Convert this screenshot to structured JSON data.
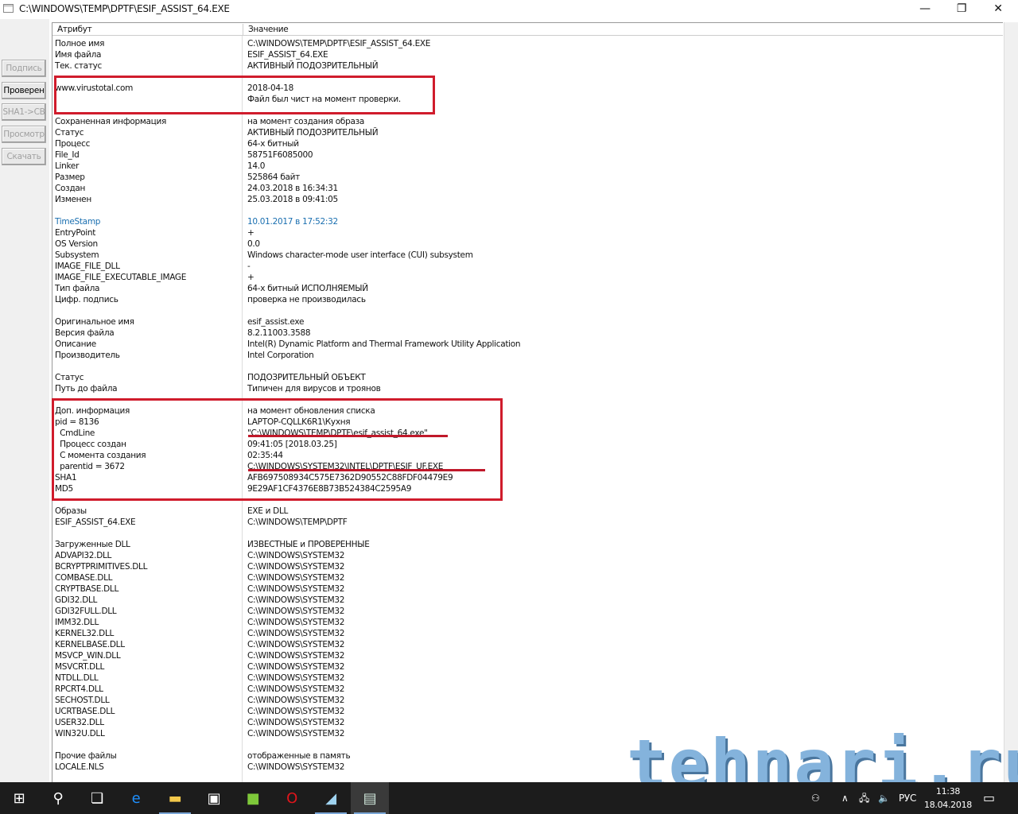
{
  "window": {
    "title": "C:\\WINDOWS\\TEMP\\DPTF\\ESIF_ASSIST_64.EXE",
    "minimize": "—",
    "maximize": "❐",
    "close": "✕"
  },
  "side_buttons": [
    {
      "label": "Подпись",
      "enabled": false
    },
    {
      "label": "Проверен",
      "enabled": true
    },
    {
      "label": "SHA1->CB",
      "enabled": false
    },
    {
      "label": "Просмотр",
      "enabled": false
    },
    {
      "label": "Скачать",
      "enabled": false
    }
  ],
  "table": {
    "headers": [
      "Атрибут",
      "Значение"
    ],
    "rows": [
      [
        "Полное имя",
        "C:\\WINDOWS\\TEMP\\DPTF\\ESIF_ASSIST_64.EXE"
      ],
      [
        "Имя файла",
        "ESIF_ASSIST_64.EXE"
      ],
      [
        "Тек. статус",
        "АКТИВНЫЙ ПОДОЗРИТЕЛЬНЫЙ"
      ],
      [
        "",
        ""
      ],
      [
        "www.virustotal.com",
        "2018-04-18"
      ],
      [
        "",
        "Файл был чист на момент проверки."
      ],
      [
        "",
        ""
      ],
      [
        "Сохраненная информация",
        "на момент создания образа"
      ],
      [
        "Статус",
        "АКТИВНЫЙ ПОДОЗРИТЕЛЬНЫЙ"
      ],
      [
        "Процесс",
        "64-х битный"
      ],
      [
        "File_Id",
        "58751F6085000"
      ],
      [
        "Linker",
        "14.0"
      ],
      [
        "Размер",
        "525864 байт"
      ],
      [
        "Создан",
        "24.03.2018 в 16:34:31"
      ],
      [
        "Изменен",
        "25.03.2018 в 09:41:05"
      ],
      [
        "",
        ""
      ],
      [
        "TimeStamp",
        "10.01.2017 в 17:52:32",
        "blue"
      ],
      [
        "EntryPoint",
        "+"
      ],
      [
        "OS Version",
        "0.0"
      ],
      [
        "Subsystem",
        "Windows character-mode user interface (CUI) subsystem"
      ],
      [
        "IMAGE_FILE_DLL",
        "-"
      ],
      [
        "IMAGE_FILE_EXECUTABLE_IMAGE",
        "+"
      ],
      [
        "Тип файла",
        "64-х битный ИСПОЛНЯЕМЫЙ"
      ],
      [
        "Цифр. подпись",
        "проверка не производилась"
      ],
      [
        "",
        ""
      ],
      [
        "Оригинальное имя",
        "esif_assist.exe"
      ],
      [
        "Версия файла",
        "8.2.11003.3588"
      ],
      [
        "Описание",
        "Intel(R) Dynamic Platform and Thermal Framework Utility Application"
      ],
      [
        "Производитель",
        "Intel Corporation"
      ],
      [
        "",
        ""
      ],
      [
        "Статус",
        "ПОДОЗРИТЕЛЬНЫЙ ОБЪЕКТ"
      ],
      [
        "Путь до файла",
        "Типичен для вирусов и троянов"
      ],
      [
        "",
        ""
      ],
      [
        "Доп. информация",
        "на момент обновления списка"
      ],
      [
        "pid = 8136",
        "LAPTOP-CQLLK6R1\\Кухня"
      ],
      [
        "  CmdLine",
        "\"C:\\WINDOWS\\TEMP\\DPTF\\esif_assist_64.exe\""
      ],
      [
        "  Процесс создан",
        "09:41:05 [2018.03.25]"
      ],
      [
        "  С момента создания",
        "02:35:44"
      ],
      [
        "  parentid = 3672",
        "C:\\WINDOWS\\SYSTEM32\\INTEL\\DPTF\\ESIF_UF.EXE"
      ],
      [
        "SHA1",
        "AFB697508934C575E7362D90552C88FDF04479E9"
      ],
      [
        "MD5",
        "9E29AF1CF4376E8B73B524384C2595A9"
      ],
      [
        "",
        ""
      ],
      [
        "Образы",
        "EXE и DLL"
      ],
      [
        "ESIF_ASSIST_64.EXE",
        "C:\\WINDOWS\\TEMP\\DPTF"
      ],
      [
        "",
        ""
      ],
      [
        "Загруженные DLL",
        "ИЗВЕСТНЫЕ и ПРОВЕРЕННЫЕ"
      ],
      [
        "ADVAPI32.DLL",
        "C:\\WINDOWS\\SYSTEM32"
      ],
      [
        "BCRYPTPRIMITIVES.DLL",
        "C:\\WINDOWS\\SYSTEM32"
      ],
      [
        "COMBASE.DLL",
        "C:\\WINDOWS\\SYSTEM32"
      ],
      [
        "CRYPTBASE.DLL",
        "C:\\WINDOWS\\SYSTEM32"
      ],
      [
        "GDI32.DLL",
        "C:\\WINDOWS\\SYSTEM32"
      ],
      [
        "GDI32FULL.DLL",
        "C:\\WINDOWS\\SYSTEM32"
      ],
      [
        "IMM32.DLL",
        "C:\\WINDOWS\\SYSTEM32"
      ],
      [
        "KERNEL32.DLL",
        "C:\\WINDOWS\\SYSTEM32"
      ],
      [
        "KERNELBASE.DLL",
        "C:\\WINDOWS\\SYSTEM32"
      ],
      [
        "MSVCP_WIN.DLL",
        "C:\\WINDOWS\\SYSTEM32"
      ],
      [
        "MSVCRT.DLL",
        "C:\\WINDOWS\\SYSTEM32"
      ],
      [
        "NTDLL.DLL",
        "C:\\WINDOWS\\SYSTEM32"
      ],
      [
        "RPCRT4.DLL",
        "C:\\WINDOWS\\SYSTEM32"
      ],
      [
        "SECHOST.DLL",
        "C:\\WINDOWS\\SYSTEM32"
      ],
      [
        "UCRTBASE.DLL",
        "C:\\WINDOWS\\SYSTEM32"
      ],
      [
        "USER32.DLL",
        "C:\\WINDOWS\\SYSTEM32"
      ],
      [
        "WIN32U.DLL",
        "C:\\WINDOWS\\SYSTEM32"
      ],
      [
        "",
        ""
      ],
      [
        "Прочие файлы",
        "отображенные в память"
      ],
      [
        "LOCALE.NLS",
        "C:\\WINDOWS\\SYSTEM32"
      ]
    ]
  },
  "watermark": "tehnari.ru",
  "taskbar": {
    "items": [
      {
        "name": "start",
        "icon": "windows-icon",
        "glyph": "⊞"
      },
      {
        "name": "search",
        "icon": "search-icon",
        "glyph": "⚲"
      },
      {
        "name": "task-view",
        "icon": "task-view-icon",
        "glyph": "❏"
      },
      {
        "name": "edge",
        "icon": "edge-icon",
        "glyph": "e"
      },
      {
        "name": "explorer",
        "icon": "folder-icon",
        "glyph": "▬"
      },
      {
        "name": "store",
        "icon": "store-icon",
        "glyph": "▣"
      },
      {
        "name": "app-green",
        "icon": "green-app-icon",
        "glyph": "■"
      },
      {
        "name": "opera",
        "icon": "opera-icon",
        "glyph": "O"
      },
      {
        "name": "app-blue",
        "icon": "blue-app-icon",
        "glyph": "◢"
      },
      {
        "name": "current-app",
        "icon": "window-app-icon",
        "glyph": "▤"
      }
    ],
    "language": "РУС",
    "time": "11:38",
    "date": "18.04.2018"
  },
  "colors": {
    "highlight": "#d01c2c",
    "link": "#1a6fb0",
    "taskbar": "#1c1c1c"
  }
}
